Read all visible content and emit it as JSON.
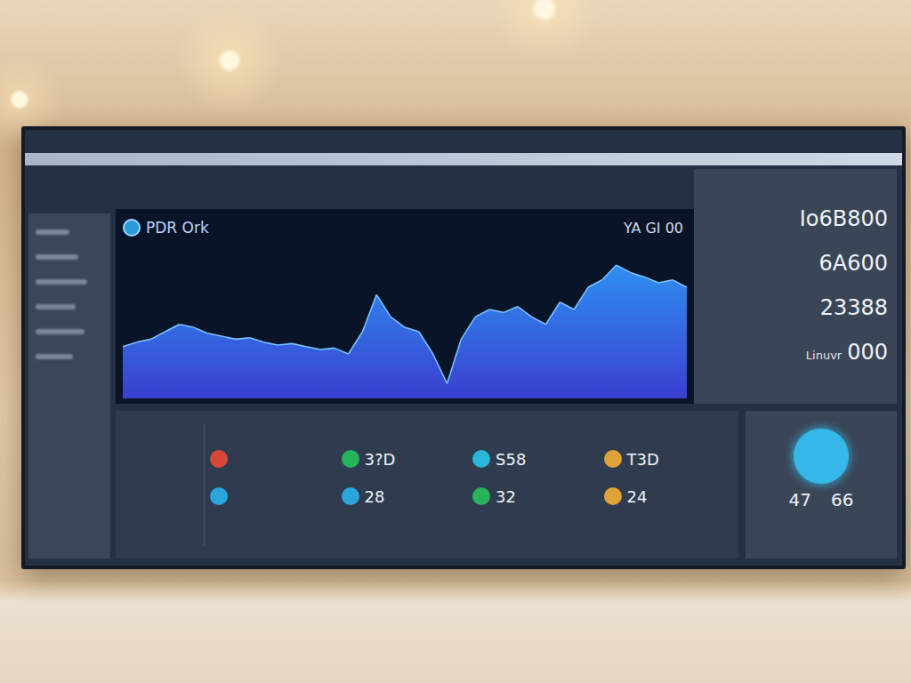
{
  "dashboard": {
    "logo_text": "PDR Ork",
    "chart_value": "YA GI 00"
  },
  "stats": [
    {
      "label": "",
      "value": "Io6B800"
    },
    {
      "label": "",
      "value": "6A600"
    },
    {
      "label": "",
      "value": "23388"
    },
    {
      "label": "Linuvr",
      "value": "000"
    }
  ],
  "chart": {
    "series": [
      {
        "values": [
          35,
          38,
          40,
          45,
          50,
          48,
          44,
          42,
          40,
          41,
          38,
          36,
          37,
          35,
          33,
          34,
          30,
          45,
          70,
          55,
          48,
          45,
          30,
          10,
          40,
          55,
          60,
          58,
          62,
          55,
          50,
          65,
          60,
          75,
          80,
          90,
          85,
          82,
          78,
          80,
          75
        ]
      }
    ]
  },
  "cards": [
    [
      {
        "value": "",
        "color": "#d9473b"
      },
      {
        "value": "",
        "color": "#2aa6dc"
      }
    ],
    [
      {
        "value": "3?D",
        "color": "#27b35a"
      },
      {
        "value": "28",
        "color": "#2aa6dc"
      }
    ],
    [
      {
        "value": "S58",
        "color": "#2ab6d8"
      },
      {
        "value": "32",
        "color": "#27b35a"
      }
    ],
    [
      {
        "value": "T3D",
        "color": "#e0a33a"
      },
      {
        "value": "24",
        "color": "#e0a33a"
      }
    ]
  ],
  "gauge": {
    "values": [
      "47",
      "66"
    ]
  }
}
